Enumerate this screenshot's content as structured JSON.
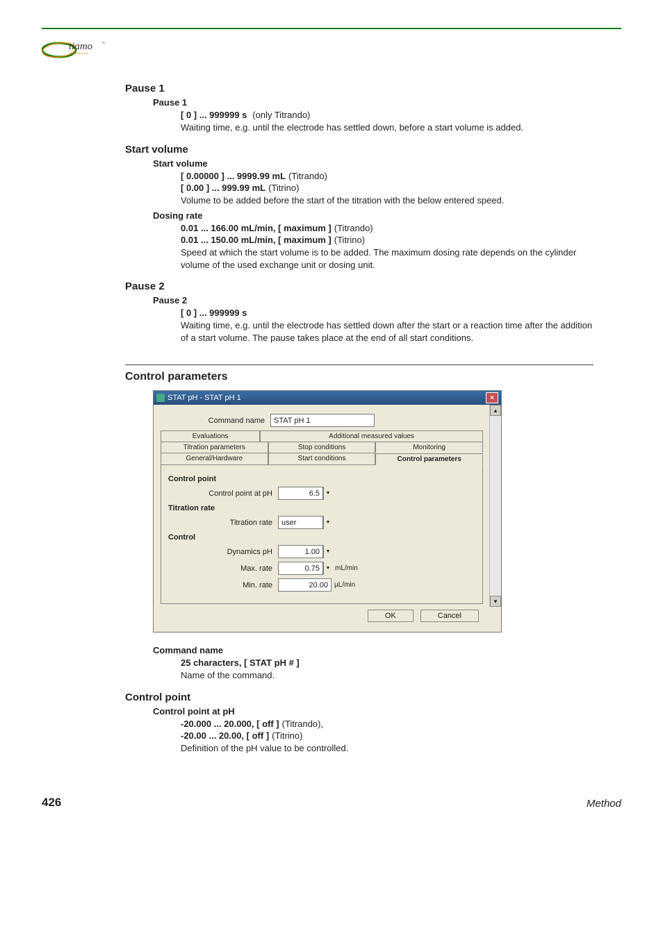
{
  "logo": {
    "brand": "tiamo",
    "tm": "™",
    "tagline": "titration and more"
  },
  "sections": {
    "pause1": {
      "heading": "Pause 1",
      "param": "Pause 1",
      "range": "[ 0 ] ... 999999 s",
      "note": "(only Titrando)",
      "desc": "Waiting time, e.g. until the electrode has settled down, before a start volume is added."
    },
    "startvol": {
      "heading": "Start volume",
      "sv": {
        "param": "Start volume",
        "r1": "[ 0.00000 ] ... 9999.99 mL",
        "n1": "(Titrando)",
        "r2": "[ 0.00 ] ... 999.99 mL",
        "n2": "(Titrino)",
        "desc": "Volume to be added before the start of the titration with the below entered speed."
      },
      "dr": {
        "param": "Dosing rate",
        "r1": "0.01 ... 166.00 mL/min, [ maximum ]",
        "n1": "(Titrando)",
        "r2": "0.01 ... 150.00 mL/min, [ maximum ]",
        "n2": "(Titrino)",
        "desc": "Speed at which the start volume is to be added. The maximum dosing rate depends on the cylinder volume of the used exchange unit or dosing unit."
      }
    },
    "pause2": {
      "heading": "Pause 2",
      "param": "Pause 2",
      "range": "[ 0 ] ... 999999 s",
      "desc": "Waiting time, e.g. until the electrode has settled down after the start or a reaction time after the addition of a start volume. The pause takes place at the end of all start conditions."
    },
    "cparams": {
      "heading": "Control parameters"
    },
    "cmdname": {
      "param": "Command name",
      "range": "25 characters, [ STAT pH # ]",
      "desc": "Name of the command."
    },
    "cpoint": {
      "heading": "Control point",
      "param": "Control point at pH",
      "r1": "-20.000 ... 20.000, [ off ]",
      "n1": "(Titrando),",
      "r2": "-20.00 ... 20.00, [ off ]",
      "n2": "(Titrino)",
      "desc": "Definition of the pH value to be controlled."
    }
  },
  "dialog": {
    "title": "STAT pH - STAT pH 1",
    "cmd_label": "Command name",
    "cmd_value": "STAT pH 1",
    "tabs_row1": [
      "Evaluations",
      "Additional measured values"
    ],
    "tabs_row2": [
      "Titration parameters",
      "Stop conditions",
      "Monitoring"
    ],
    "tabs_row3": [
      "General/Hardware",
      "Start conditions",
      "Control parameters"
    ],
    "groups": {
      "cp": {
        "title": "Control point",
        "label": "Control point at pH",
        "value": "6.5"
      },
      "tr": {
        "title": "Titration rate",
        "label": "Titration rate",
        "value": "user"
      },
      "ctrl": {
        "title": "Control",
        "dyn_label": "Dynamics pH",
        "dyn_value": "1.00",
        "max_label": "Max. rate",
        "max_value": "0.75",
        "max_unit": "mL/min",
        "min_label": "Min. rate",
        "min_value": "20.00",
        "min_unit": "µL/min"
      }
    },
    "ok": "OK",
    "cancel": "Cancel"
  },
  "footer": {
    "page": "426",
    "section": "Method"
  }
}
